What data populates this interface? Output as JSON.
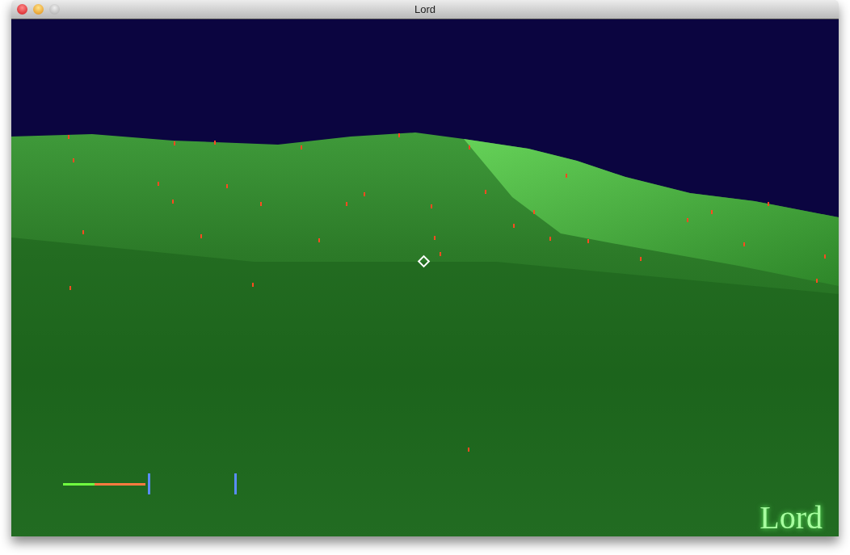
{
  "window": {
    "title": "Lord"
  },
  "hud": {
    "meter": {
      "level": 0.38
    }
  },
  "logo": "Lord"
}
